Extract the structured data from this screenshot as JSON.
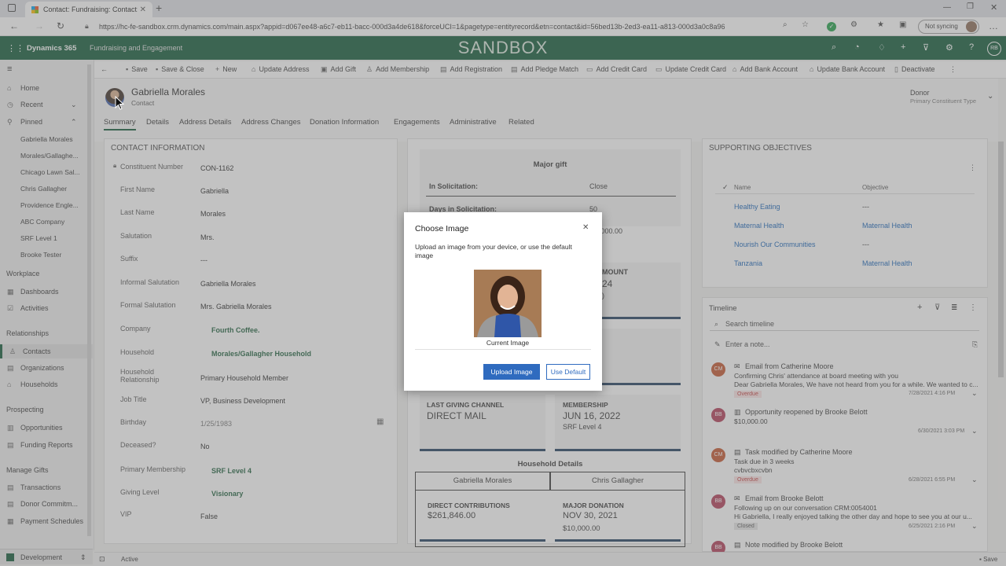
{
  "browser": {
    "tab_title": "Contact: Fundraising: Contact: G",
    "url": "https://hc-fe-sandbox.crm.dynamics.com/main.aspx?appid=d067ee48-a6c7-eb11-bacc-000d3a4de618&forceUCI=1&pagetype=entityrecord&etn=contact&id=56bed13b-2ed3-ea11-a813-000d3a0c8a96",
    "sync_label": "Not syncing"
  },
  "appbar": {
    "brand": "Dynamics 365",
    "app_name": "Fundraising and Engagement",
    "env_label": "SANDBOX",
    "user_initials": "RB"
  },
  "left_nav": {
    "home": "Home",
    "recent": "Recent",
    "pinned": "Pinned",
    "pinned_items": [
      "Gabriella Morales",
      "Morales/Gallaghe...",
      "Chicago Lawn Sal...",
      "Chris Gallagher",
      "Providence Engle...",
      "ABC Company",
      "SRF Level 1",
      "Brooke Tester"
    ],
    "workplace": "Workplace",
    "dashboards": "Dashboards",
    "activities": "Activities",
    "relationships": "Relationships",
    "contacts": "Contacts",
    "organizations": "Organizations",
    "households": "Households",
    "prospecting": "Prospecting",
    "opportunities": "Opportunities",
    "funding_reports": "Funding Reports",
    "manage_gifts": "Manage Gifts",
    "transactions": "Transactions",
    "donor_commitments": "Donor Commitm...",
    "payment_schedules": "Payment Schedules",
    "area": "Development"
  },
  "commands": [
    "Save",
    "Save & Close",
    "New",
    "Update Address",
    "Add Gift",
    "Add Membership",
    "Add Registration",
    "Add Pledge Match",
    "Add Credit Card",
    "Update Credit Card",
    "Add Bank Account",
    "Update Bank Account",
    "Deactivate"
  ],
  "record": {
    "name": "Gabriella Morales",
    "entity": "Contact",
    "type_value": "Donor",
    "type_label": "Primary Constituent Type"
  },
  "tabs": [
    "Summary",
    "Details",
    "Address Details",
    "Address Changes",
    "Donation Information",
    "Engagements",
    "Administrative",
    "Related"
  ],
  "contact_info": {
    "title": "CONTACT INFORMATION",
    "fields": [
      {
        "label": "Constituent Number",
        "value": "CON-1162"
      },
      {
        "label": "First Name",
        "value": "Gabriella"
      },
      {
        "label": "Last Name",
        "value": "Morales"
      },
      {
        "label": "Salutation",
        "value": "Mrs."
      },
      {
        "label": "Suffix",
        "value": "---"
      },
      {
        "label": "Informal Salutation",
        "value": "Gabriella Morales"
      },
      {
        "label": "Formal Salutation",
        "value": "Mrs. Gabriella Morales"
      },
      {
        "label": "Company",
        "value": "Fourth Coffee."
      },
      {
        "label": "Household",
        "value": "Morales/Gallagher Household"
      },
      {
        "label": "Household Relationship",
        "value": "Primary Household Member"
      },
      {
        "label": "Job Title",
        "value": "VP, Business Development"
      },
      {
        "label": "Birthday",
        "value": "1/25/1983"
      },
      {
        "label": "Deceased?",
        "value": "No"
      },
      {
        "label": "Primary Membership",
        "value": "SRF Level 4"
      },
      {
        "label": "Giving Level",
        "value": "Visionary"
      },
      {
        "label": "VIP",
        "value": "False"
      }
    ]
  },
  "summary": {
    "major_gift": "Major gift",
    "in_solicitation_label": "In Solicitation:",
    "in_solicitation_value": "Close",
    "days_label": "Days in Solicitation:",
    "days_value": "50",
    "amount_fragment": ",000.00",
    "amount_tile": "MOUNT",
    "amount_tile_value": "24",
    "amount_tile_sub": ")",
    "last_channel_label": "LAST GIVING CHANNEL",
    "last_channel_value": "DIRECT MAIL",
    "membership_label": "MEMBERSHIP",
    "membership_value": "JUN 16, 2022",
    "membership_sub": "SRF Level 4",
    "household_details": "Household Details",
    "hh_member_1": "Gabriella Morales",
    "hh_member_2": "Chris Gallagher",
    "direct_label": "DIRECT CONTRIBUTIONS",
    "direct_value": "$261,846.00",
    "major_label": "MAJOR DONATION",
    "major_value": "NOV 30, 2021",
    "major_sub": "$10,000.00"
  },
  "objectives": {
    "title": "SUPPORTING OBJECTIVES",
    "col_name": "Name",
    "col_objective": "Objective",
    "rows": [
      {
        "name": "Healthy Eating",
        "objective": "---"
      },
      {
        "name": "Maternal Health",
        "objective": "Maternal Health"
      },
      {
        "name": "Nourish Our Communities",
        "objective": "---"
      },
      {
        "name": "Tanzania",
        "objective": "Maternal Health"
      }
    ]
  },
  "timeline": {
    "title": "Timeline",
    "search_placeholder": "Search timeline",
    "note_placeholder": "Enter a note...",
    "items": [
      {
        "initials": "CM",
        "color": "#c4532b",
        "title": "Email from Catherine Moore",
        "line1": "Confirming Chris' attendance at board meeting with you",
        "line2": "Dear Gabriella Morales, We have not heard from you for a while. We wanted to c...",
        "badge": "Overdue",
        "date": "7/28/2021 4:16 PM"
      },
      {
        "initials": "BB",
        "color": "#b13a54",
        "title": "Opportunity reopened by Brooke Belott",
        "line1": "$10,000.00",
        "line2": "",
        "badge": "",
        "date": "6/30/2021 3:03 PM"
      },
      {
        "initials": "CM",
        "color": "#c4532b",
        "title": "Task modified by Catherine Moore",
        "line1": "Task due in 3 weeks",
        "line2": "cvbvcbxcvbn",
        "badge": "Overdue",
        "date": "6/28/2021 6:55 PM"
      },
      {
        "initials": "BB",
        "color": "#b13a54",
        "title": "Email from Brooke Belott",
        "line1": "Following up on our conversation CRM:0054001",
        "line2": "Hi Gabriella, I really enjoyed talking the other day and hope to see you at our u...",
        "badge": "Closed",
        "date": "6/25/2021 2:16 PM"
      },
      {
        "initials": "BB",
        "color": "#b13a54",
        "title": "Note modified by Brooke Belott",
        "line1": "",
        "line2": "",
        "badge": "",
        "date": ""
      }
    ]
  },
  "dialog": {
    "title": "Choose Image",
    "message": "Upload an image from your device, or use the default image",
    "caption": "Current Image",
    "upload_label": "Upload Image",
    "default_label": "Use Default"
  },
  "status": {
    "state": "Active",
    "save": "Save"
  }
}
